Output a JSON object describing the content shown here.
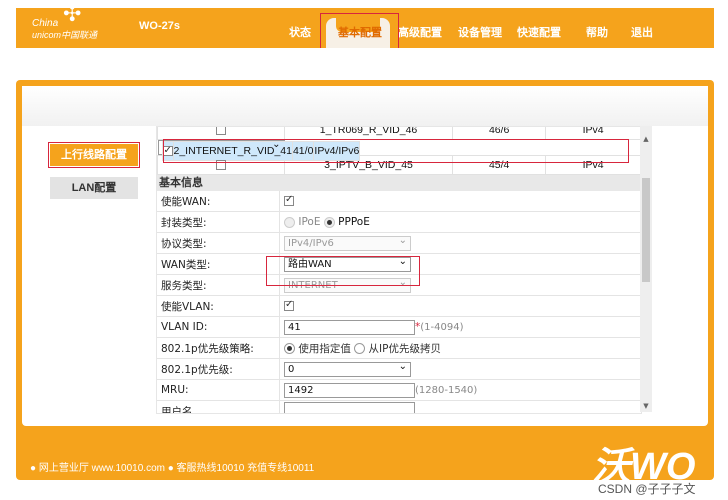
{
  "header": {
    "logo_line1": "China",
    "logo_line2": "unicom中国联通",
    "model": "WO-27s",
    "nav": [
      "状态",
      "基本配置",
      "高级配置",
      "设备管理",
      "快速配置",
      "帮助",
      "退出"
    ],
    "active_nav": "基本配置"
  },
  "sidebar": {
    "items": [
      "上行线路配置",
      "LAN配置"
    ],
    "active": "上行线路配置"
  },
  "vlan_table": {
    "rows": [
      {
        "checked": false,
        "name": "1_TR069_R_VID_46",
        "vlan": "46/6",
        "ip": "IPv4",
        "selected": false
      },
      {
        "checked": true,
        "name": "2_INTERNET_R_VID_41",
        "vlan": "41/0",
        "ip": "IPv4/IPv6",
        "selected": true
      },
      {
        "checked": false,
        "name": "3_IPTV_B_VID_45",
        "vlan": "45/4",
        "ip": "IPv4",
        "selected": false
      }
    ]
  },
  "basic": {
    "section_title": "基本信息",
    "enable_wan_label": "使能WAN:",
    "enable_wan": true,
    "encap_label": "封装类型:",
    "encap_opt1": "IPoE",
    "encap_opt2": "PPPoE",
    "encap_selected": "PPPoE",
    "protocol_label": "协议类型:",
    "protocol_value": "IPv4/IPv6",
    "wan_type_label": "WAN类型:",
    "wan_type_value": "路由WAN",
    "service_label": "服务类型:",
    "service_value": "INTERNET",
    "enable_vlan_label": "使能VLAN:",
    "enable_vlan": true,
    "vlan_id_label": "VLAN ID:",
    "vlan_id_value": "41",
    "vlan_id_hint": "(1-4094)",
    "policy_label": "802.1p优先级策略:",
    "policy_opt1": "使用指定值",
    "policy_opt2": "从IP优先级拷贝",
    "priority_label": "802.1p优先级:",
    "priority_value": "0",
    "mru_label": "MRU:",
    "mru_value": "1492",
    "mru_hint": "(1280-1540)",
    "username_label": "用户名"
  },
  "footer": {
    "text": "● 网上营业厅 www.10010.com ● 客服热线10010 充值专线10011",
    "brand": "沃WO"
  },
  "watermark": "CSDN @子子子文",
  "colors": {
    "brand": "#f5a31c",
    "highlight": "#d7263d",
    "selected_row": "#cfe8fb"
  }
}
